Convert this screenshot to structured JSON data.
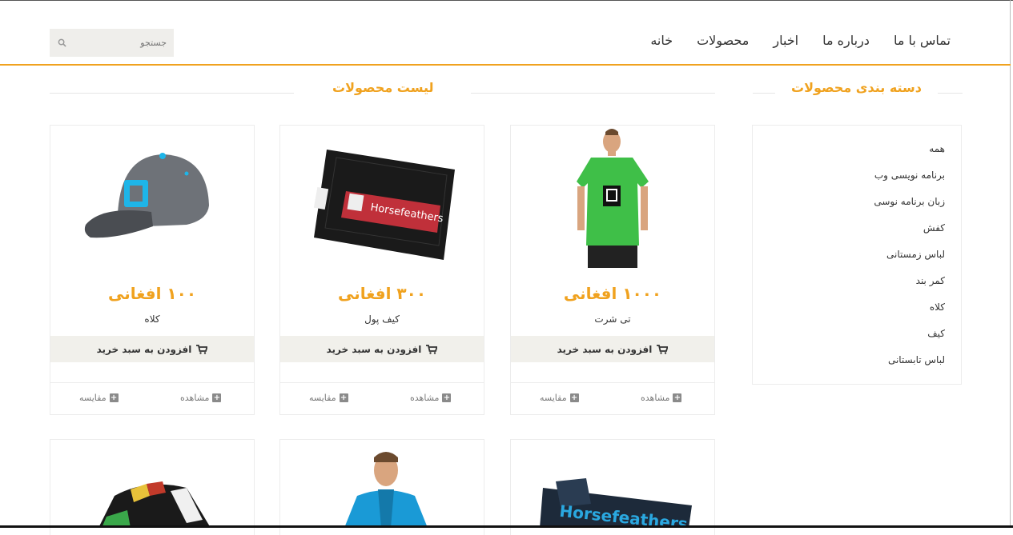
{
  "nav": {
    "items": [
      "خانه",
      "محصولات",
      "اخبار",
      "درباره ما",
      "تماس با ما"
    ]
  },
  "search": {
    "placeholder": "جستجو",
    "icon": "search-icon"
  },
  "sections": {
    "categories_title": "دسته بندی محصولات",
    "products_title": "لیست محصولات"
  },
  "categories": [
    "همه",
    "برنامه نویسی وب",
    "زبان برنامه نوسی",
    "کفش",
    "لباس زمستانی",
    "کمر بند",
    "کلاه",
    "کیف",
    "لباس تابستانی"
  ],
  "products": [
    {
      "name": "تی شرت",
      "price": "۱۰۰۰ افغانی",
      "add_to_cart": "افزودن به سبد خرید",
      "view": "مشاهده",
      "compare": "مقایسه",
      "image": "green-tshirt"
    },
    {
      "name": "کیف پول",
      "price": "۳۰۰ افغانی",
      "add_to_cart": "افزودن به سبد خرید",
      "view": "مشاهده",
      "compare": "مقایسه",
      "image": "wallet"
    },
    {
      "name": "کلاه",
      "price": "۱۰۰ افغانی",
      "add_to_cart": "افزودن به سبد خرید",
      "view": "مشاهده",
      "compare": "مقایسه",
      "image": "cap"
    }
  ],
  "colors": {
    "accent": "#f0a21f",
    "button_bg": "#f1f0eb",
    "border": "#ececec"
  }
}
